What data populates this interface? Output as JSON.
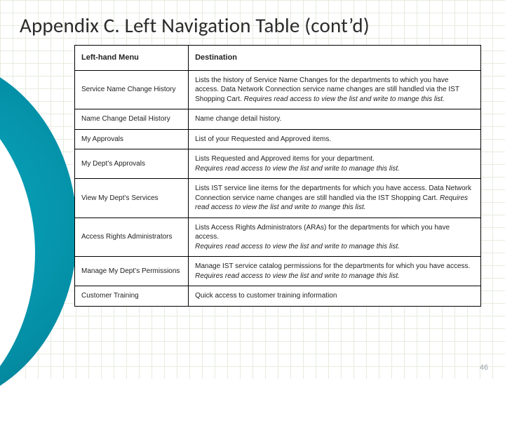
{
  "title": "Appendix C. Left Navigation Table (cont’d)",
  "table": {
    "headers": {
      "menu": "Left-hand Menu",
      "dest": "Destination"
    },
    "rows": [
      {
        "menu": "Service Name Change History",
        "dest_main": "Lists the history of Service Name Changes for the departments to which you have access. Data Network Connection service name changes are still handled via the IST Shopping Cart.",
        "dest_italic": "Requires read access to view the list and write to mange this list."
      },
      {
        "menu": "Name Change Detail History",
        "dest_main": "Name change detail history.",
        "dest_italic": ""
      },
      {
        "menu": "My Approvals",
        "dest_main": "List of your Requested and Approved items.",
        "dest_italic": ""
      },
      {
        "menu": "My Dept’s Approvals",
        "dest_main": "Lists Requested and Approved items for your department.",
        "dest_italic": "Requires read access to view the list and write to manage this list."
      },
      {
        "menu": "View My Dept’s Services",
        "dest_main": "Lists IST service line items for the departments for which you have access. Data Network Connection service name changes are still handled via the IST Shopping Cart.",
        "dest_italic": "Requires read access to view the list and write to mange this list."
      },
      {
        "menu": "Access Rights Administrators",
        "dest_main": "Lists Access Rights Administrators (ARAs) for the departments for which you have access.",
        "dest_italic": "Requires read access to view the list and write to manage this list."
      },
      {
        "menu": "Manage My Dept’s Permissions",
        "dest_main": "Manage IST service catalog permissions for the departments for which you have access.",
        "dest_italic": "Requires read access to view the list and write to manage this list."
      },
      {
        "menu": "Customer Training",
        "dest_main": "Quick access to customer training information",
        "dest_italic": ""
      }
    ]
  },
  "page_number": "46"
}
